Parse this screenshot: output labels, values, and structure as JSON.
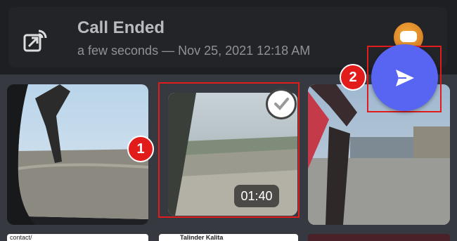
{
  "call": {
    "title": "Call Ended",
    "subtitle": "a few seconds — Nov 25, 2021 12:18 AM",
    "icon": "call-ended-icon"
  },
  "gallery": {
    "selected_video_duration": "01:40",
    "selected_icon": "checkmark-icon",
    "bottom_row_text_left": "contact/",
    "bottom_row_text_middle": "Talinder Kalita"
  },
  "send_button": {
    "icon": "send-icon",
    "color": "#5865f2"
  },
  "annotations": {
    "marker_1": "1",
    "marker_2": "2",
    "color": "#e21b1b"
  }
}
